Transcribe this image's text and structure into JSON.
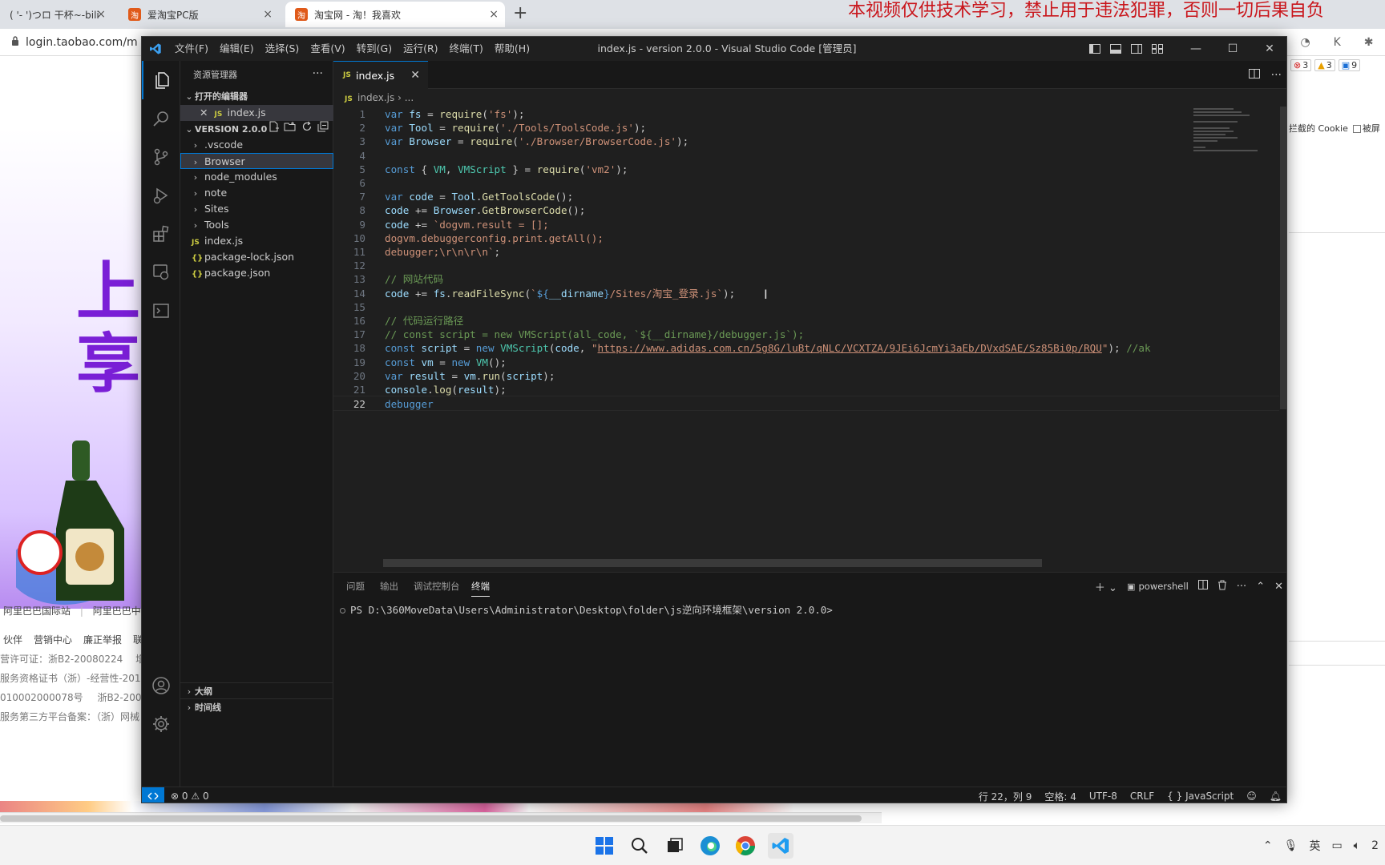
{
  "browser": {
    "tabs": [
      {
        "label": "( '- ')つロ 干杯~-bili",
        "favicon": "bili"
      },
      {
        "label": "爱淘宝PC版",
        "favicon": "taobao"
      },
      {
        "label": "淘宝网 - 淘！我喜欢",
        "favicon": "taobao"
      }
    ],
    "banner_text": "本视频仅供技术学习，禁止用于违法犯罪，否则一切后果自负",
    "url": "login.taobao.com/m",
    "promo_chars": [
      "上",
      "享"
    ],
    "footer_links": [
      "阿里巴巴国际站",
      "阿里巴巴中"
    ],
    "footer_row2": [
      "伙伴",
      "营销中心",
      "廉正举报",
      "联"
    ],
    "footer_lines": [
      "营许可证：浙B2-20080224",
      "增值",
      "服务资格证书（浙）-经营性-2018-",
      "010002000078号",
      "浙B2-2008",
      "服务第三方平台备案：（浙）网械"
    ],
    "right_badges": {
      "errors": "3",
      "warnings": "3",
      "info": "9"
    },
    "cookie_text": "拦截的 Cookie",
    "pin_text": "被屏"
  },
  "vscode": {
    "menu": [
      "文件(F)",
      "编辑(E)",
      "选择(S)",
      "查看(V)",
      "转到(G)",
      "运行(R)",
      "终端(T)",
      "帮助(H)"
    ],
    "window_title": "index.js - version 2.0.0 - Visual Studio Code [管理员]",
    "sidebar": {
      "title": "资源管理器",
      "open_editors_header": "打开的编辑器",
      "open_editor_file": "index.js",
      "folder_header": "VERSION 2.0.0",
      "tree": [
        {
          "name": ".vscode",
          "type": "folder"
        },
        {
          "name": "Browser",
          "type": "folder"
        },
        {
          "name": "node_modules",
          "type": "folder"
        },
        {
          "name": "note",
          "type": "folder"
        },
        {
          "name": "Sites",
          "type": "folder"
        },
        {
          "name": "Tools",
          "type": "folder"
        },
        {
          "name": "index.js",
          "type": "js"
        },
        {
          "name": "package-lock.json",
          "type": "json"
        },
        {
          "name": "package.json",
          "type": "json"
        }
      ],
      "outline_header": "大纲",
      "timeline_header": "时间线"
    },
    "tab_label": "index.js",
    "breadcrumb": [
      "index.js",
      "..."
    ],
    "code_lines": [
      "var fs = require('fs');",
      "var Tool = require('./Tools/ToolsCode.js');",
      "var Browser = require('./Browser/BrowserCode.js');",
      "",
      "const { VM, VMScript } = require('vm2');",
      "",
      "var code = Tool.GetToolsCode();",
      "code += Browser.GetBrowserCode();",
      "code += `dogvm.result = [];",
      "dogvm.debuggerconfig.print.getAll();",
      "debugger;\\r\\n\\r\\n`;",
      "",
      "// 网站代码",
      "code += fs.readFileSync(`${__dirname}/Sites/淘宝_登录.js`);",
      "",
      "// 代码运行路径",
      "// const script = new VMScript(all_code, `${__dirname}/debugger.js`);",
      "const script = new VMScript(code, \"https://www.adidas.com.cn/5g8G/luBt/qNLC/VCXTZA/9JEi6JcmYi3aEb/DVxdSAE/Sz85Bi0p/RQU\"); //ak",
      "const vm = new VM();",
      "var result = vm.run(script);",
      "console.log(result);",
      "debugger"
    ],
    "current_line": 22,
    "panel": {
      "tabs": [
        "问题",
        "输出",
        "调试控制台",
        "终端"
      ],
      "active_tab": "终端",
      "shell": "powershell",
      "prompt": "PS D:\\360MoveData\\Users\\Administrator\\Desktop\\folder\\js逆向环境框架\\version 2.0.0>"
    },
    "status": {
      "errors": "0",
      "warnings": "0",
      "position": "行 22，列 9",
      "spaces": "空格: 4",
      "encoding": "UTF-8",
      "eol": "CRLF",
      "language": "JavaScript"
    }
  },
  "taskbar": {
    "ime": "英",
    "clock_fragment": "2"
  }
}
